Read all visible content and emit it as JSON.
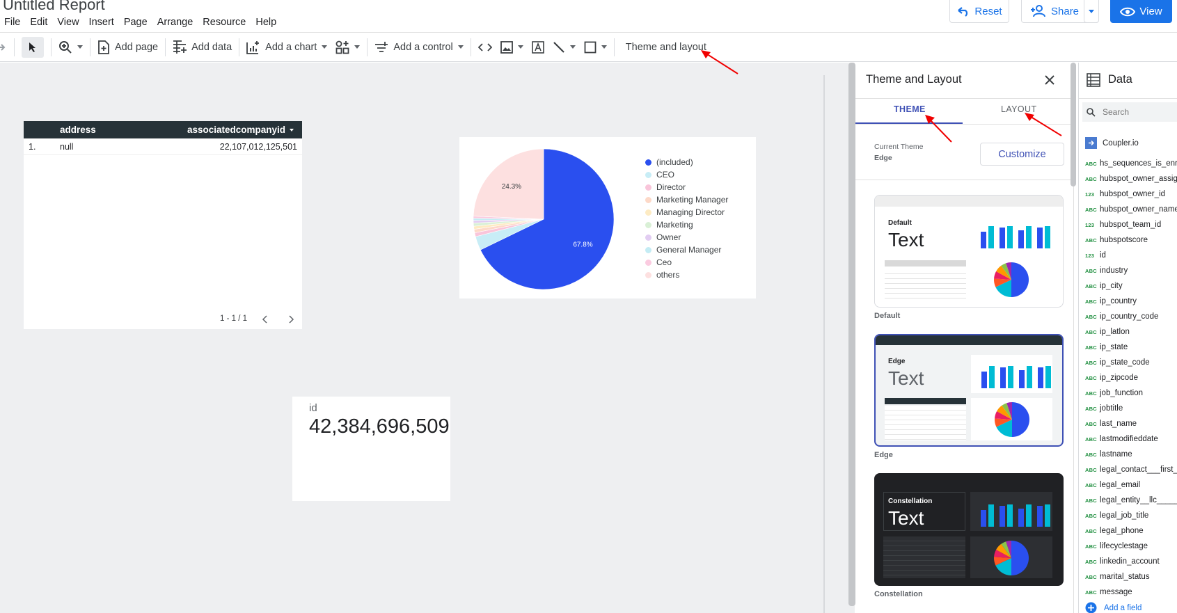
{
  "report": {
    "title": "Untitled Report"
  },
  "menu": [
    "File",
    "Edit",
    "View",
    "Insert",
    "Page",
    "Arrange",
    "Resource",
    "Help"
  ],
  "header_buttons": {
    "reset": "Reset",
    "share": "Share",
    "view": "View"
  },
  "toolbar": {
    "add_page": "Add page",
    "add_data": "Add data",
    "add_chart": "Add a chart",
    "add_control": "Add a control",
    "theme_layout": "Theme and layout"
  },
  "table": {
    "columns": [
      "address",
      "associatedcompanyid"
    ],
    "rows": [
      {
        "num": "1.",
        "address": "null",
        "value": "22,107,012,125,501"
      }
    ],
    "pagination": "1 - 1 / 1"
  },
  "chart_data": {
    "type": "pie",
    "labels": [
      "(included)",
      "CEO",
      "Director",
      "Marketing Manager",
      "Managing Director",
      "Marketing",
      "Owner",
      "General Manager",
      "Ceo",
      "others"
    ],
    "values": [
      67.8,
      3.2,
      0.9,
      0.8,
      0.7,
      0.7,
      0.6,
      0.5,
      0.5,
      24.3
    ],
    "colors": [
      "#2a4fef",
      "#c8edf6",
      "#f9c5da",
      "#fdd9c8",
      "#fdebc3",
      "#d9f0d6",
      "#e2cdf2",
      "#c4ecf4",
      "#fbcbe0",
      "#fde0e0"
    ],
    "data_labels": [
      "67.8%",
      "24.3%"
    ],
    "legend_position": "right"
  },
  "scorecard": {
    "label": "id",
    "value": "42,384,696,509"
  },
  "theme_panel": {
    "title": "Theme and Layout",
    "tabs": [
      "THEME",
      "LAYOUT"
    ],
    "active_tab": "THEME",
    "current_theme_label": "Current Theme",
    "current_theme": "Edge",
    "customize": "Customize",
    "themes": [
      {
        "name": "Default",
        "card_label": "Default",
        "sample": "Text"
      },
      {
        "name": "Edge",
        "card_label": "Edge",
        "sample": "Text"
      },
      {
        "name": "Constellation",
        "card_label": "Constellation",
        "sample": "Text"
      }
    ]
  },
  "data_panel": {
    "title": "Data",
    "search_placeholder": "Search",
    "source": "Coupler.io",
    "fields": [
      {
        "type": "ABC",
        "name": "hs_sequences_is_enrolled"
      },
      {
        "type": "ABC",
        "name": "hubspot_owner_assigneddate"
      },
      {
        "type": "123",
        "name": "hubspot_owner_id"
      },
      {
        "type": "ABC",
        "name": "hubspot_owner_name"
      },
      {
        "type": "123",
        "name": "hubspot_team_id"
      },
      {
        "type": "ABC",
        "name": "hubspotscore"
      },
      {
        "type": "123",
        "name": "id"
      },
      {
        "type": "ABC",
        "name": "industry"
      },
      {
        "type": "ABC",
        "name": "ip_city"
      },
      {
        "type": "ABC",
        "name": "ip_country"
      },
      {
        "type": "ABC",
        "name": "ip_country_code"
      },
      {
        "type": "ABC",
        "name": "ip_latlon"
      },
      {
        "type": "ABC",
        "name": "ip_state"
      },
      {
        "type": "ABC",
        "name": "ip_state_code"
      },
      {
        "type": "ABC",
        "name": "ip_zipcode"
      },
      {
        "type": "ABC",
        "name": "job_function"
      },
      {
        "type": "ABC",
        "name": "jobtitle"
      },
      {
        "type": "ABC",
        "name": "last_name"
      },
      {
        "type": "ABC",
        "name": "lastmodifieddate"
      },
      {
        "type": "ABC",
        "name": "lastname"
      },
      {
        "type": "ABC",
        "name": "legal_contact___first_name"
      },
      {
        "type": "ABC",
        "name": "legal_email"
      },
      {
        "type": "ABC",
        "name": "legal_entity__llc______"
      },
      {
        "type": "ABC",
        "name": "legal_job_title"
      },
      {
        "type": "ABC",
        "name": "legal_phone"
      },
      {
        "type": "ABC",
        "name": "lifecyclestage"
      },
      {
        "type": "ABC",
        "name": "linkedin_account"
      },
      {
        "type": "ABC",
        "name": "marital_status"
      },
      {
        "type": "ABC",
        "name": "message"
      }
    ],
    "add_field": "Add a field"
  },
  "colors": {
    "accent": "#1a73e8",
    "table_header": "#263238",
    "annotation_arrow": "#f00000",
    "field_type": "#1e8e3e"
  }
}
